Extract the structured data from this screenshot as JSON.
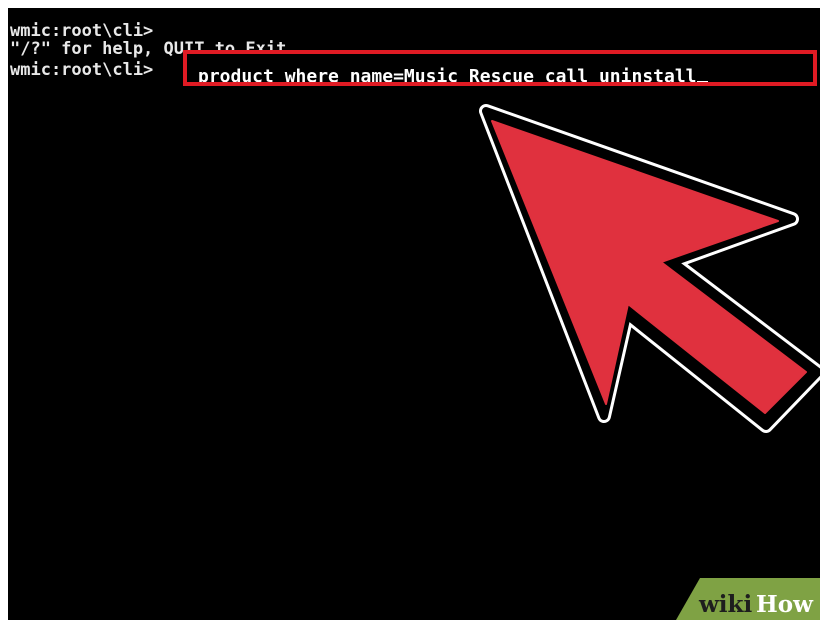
{
  "console": {
    "lines": [
      "wmic:root\\cli>",
      "\"/?\" for help, QUIT to Exit.",
      "wmic:root\\cli>"
    ],
    "command": "product where name=Music Rescue call uninstall"
  },
  "annotation": {
    "highlight_color": "#e01b24",
    "arrow_color": "#e0313e"
  },
  "watermark": {
    "text_wiki": "wiki",
    "text_how": "How"
  }
}
